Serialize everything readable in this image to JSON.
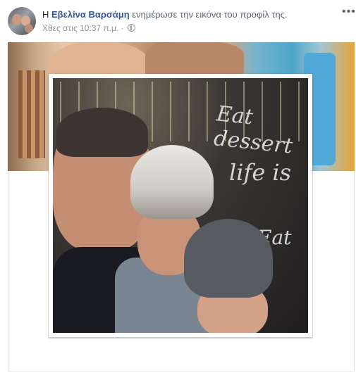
{
  "header": {
    "article": "Η",
    "author_name": "Εβελίνα Βαρσάμη",
    "action_text": "ενημέρωσε την εικόνα του προφίλ της.",
    "timestamp": "Χθες στις 10:37 π.μ.",
    "separator": "·",
    "privacy_icon": "globe-icon",
    "more_icon": "ellipsis-icon",
    "more_label": "•••"
  },
  "post": {
    "cover_photo": "cover-photo",
    "profile_picture": "profile-picture",
    "photo_glass_text": [
      "Eat dessert",
      "life is",
      "Eat"
    ]
  },
  "colors": {
    "link": "#385898",
    "meta": "#90949c",
    "text": "#1d2129"
  }
}
